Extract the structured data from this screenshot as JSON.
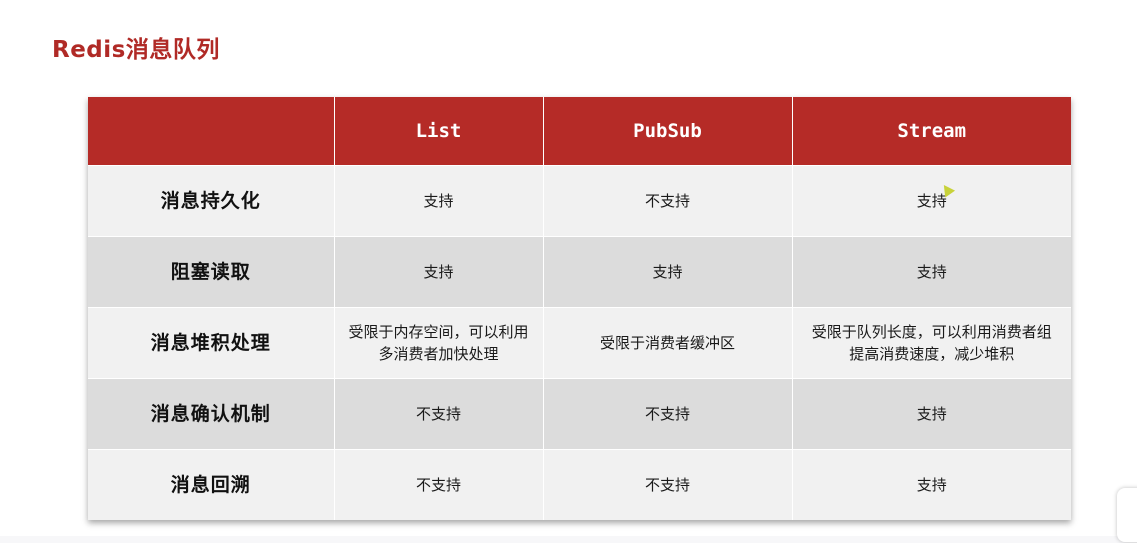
{
  "title": "Redis消息队列",
  "table": {
    "columns": [
      "",
      "List",
      "PubSub",
      "Stream"
    ],
    "rows": [
      {
        "feature": "消息持久化",
        "list": "支持",
        "pubsub": "不支持",
        "stream": "支持"
      },
      {
        "feature": "阻塞读取",
        "list": "支持",
        "pubsub": "支持",
        "stream": "支持"
      },
      {
        "feature": "消息堆积处理",
        "list": "受限于内存空间，可以利用多消费者加快处理",
        "pubsub": "受限于消费者缓冲区",
        "stream": "受限于队列长度，可以利用消费者组提高消费速度，减少堆积"
      },
      {
        "feature": "消息确认机制",
        "list": "不支持",
        "pubsub": "不支持",
        "stream": "支持"
      },
      {
        "feature": "消息回溯",
        "list": "不支持",
        "pubsub": "不支持",
        "stream": "支持"
      }
    ]
  },
  "colors": {
    "title": "#b02a26",
    "header_bg": "#b52b27",
    "row_light": "#f1f1f1",
    "row_dark": "#dcdcdc"
  }
}
